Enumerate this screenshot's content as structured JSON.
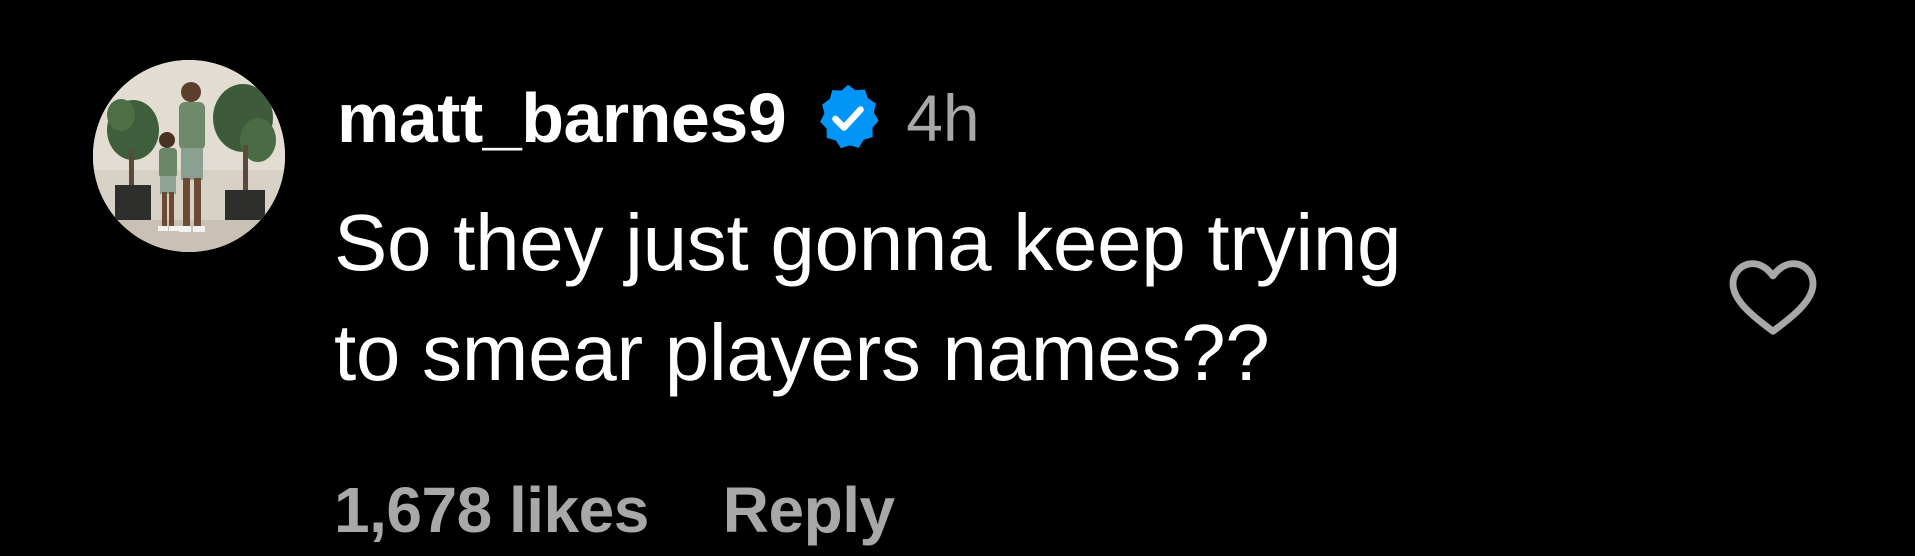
{
  "comment": {
    "username": "matt_barnes9",
    "verified_icon": "verified-badge-icon",
    "timestamp": "4h",
    "text_lines": [
      "So they just gonna keep trying",
      "to smear players names??"
    ],
    "likes": "1,678 likes",
    "reply_label": "Reply",
    "like_icon": "heart-outline-icon"
  },
  "colors": {
    "background": "#000000",
    "primary_text": "#ffffff",
    "secondary_text": "#a8a8a8",
    "verified_blue": "#0095f6"
  }
}
